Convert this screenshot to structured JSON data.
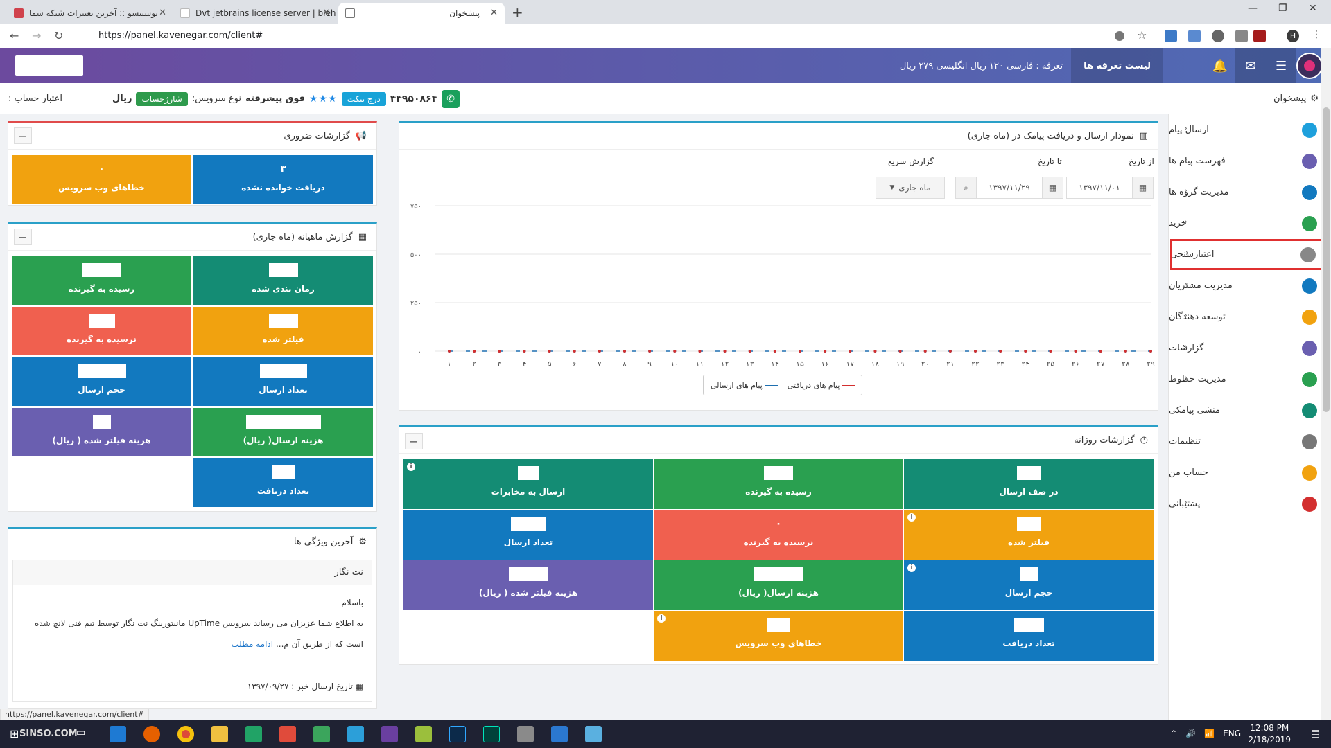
{
  "browser": {
    "tabs": [
      {
        "label": "توسینسو :: آخرین تغییرات شبکه شما"
      },
      {
        "label": "Dvt jetbrains license server | bieh"
      },
      {
        "label": "پیشخوان"
      }
    ],
    "url": "https://panel.kavenegar.com/client#"
  },
  "topbar": {
    "tariff_button": "لیست تعرفه ها",
    "tariff_text": "تعرفه : فارسی ۱۲۰ ریال انگلیسی ۲۷۹ ریال"
  },
  "infobar": {
    "dashboard_label": "پیشخوان",
    "credit_label": "اعتبار حساب :",
    "currency": "ریال",
    "charge_button": "شارژحساب",
    "service_type_label": "نوع سرویس:",
    "service_type_value": "فوق پیشرفته",
    "stars": "★★★",
    "ticket_button": "درج تیکت",
    "phone": "۴۴۹۵۰۸۶۴"
  },
  "sidebar": {
    "items": [
      {
        "label": "ارسال پیام",
        "color": "#1ea0dc"
      },
      {
        "label": "فهرست پیام ها",
        "color": "#6a5fb0"
      },
      {
        "label": "مدیریت گروه ها",
        "color": "#1279bf"
      },
      {
        "label": "خرید",
        "color": "#2aa050"
      },
      {
        "label": "اعتبارسنجی",
        "color": "#888888"
      },
      {
        "label": "مدیریت مشتریان",
        "color": "#1279bf"
      },
      {
        "label": "توسعه دهندگان",
        "color": "#f1a20f"
      },
      {
        "label": "گزارشات",
        "color": "#6a5fb0"
      },
      {
        "label": "مدیریت خطوط",
        "color": "#2aa050"
      },
      {
        "label": "منشی پیامکی",
        "color": "#148c74"
      },
      {
        "label": "تنظیمات",
        "color": "#777777"
      },
      {
        "label": "حساب من",
        "color": "#f1a20f"
      },
      {
        "label": "پشتیبانی",
        "color": "#d32f2f"
      }
    ]
  },
  "urgent": {
    "title": "گزارشات ضروری",
    "tiles": [
      {
        "label": "خطاهای وب سرویس",
        "value": "۰"
      },
      {
        "label": "دریافت خوانده نشده",
        "value": "۳"
      }
    ]
  },
  "monthly": {
    "title": "گزارش ماهیانه (ماه جاری)",
    "tiles": [
      {
        "label": "رسیده به گیرنده"
      },
      {
        "label": "زمان بندی شده"
      },
      {
        "label": "نرسیده به گیرنده"
      },
      {
        "label": "فیلتر شده"
      },
      {
        "label": "حجم ارسال"
      },
      {
        "label": "تعداد ارسال"
      },
      {
        "label": "هزینه فیلتر شده ( ریال)"
      },
      {
        "label": "هزینه ارسال( ریال)"
      },
      {
        "label": "تعداد دریافت"
      }
    ]
  },
  "features": {
    "title": "آخرین ویژگی ها",
    "card_title": "نت نگار",
    "greeting": "باسلام",
    "body": "به اطلاع شما عزیزان می رساند سرویس UpTime مانیتورینگ نت نگار توسط تیم فنی لانچ شده است که از طریق آن م...",
    "read_more": "ادامه مطلب",
    "date_label": "تاریخ ارسال خبر : ۱۳۹۷/۰۹/۲۷"
  },
  "chart_panel": {
    "title": "نمودار ارسال و دریافت پیامک در (ماه جاری)",
    "from_label": "از تاریخ",
    "to_label": "تا تاریخ",
    "quick_label": "گزارش سریع",
    "from_value": "۱۳۹۷/۱۱/۰۱",
    "to_value": "۱۳۹۷/۱۱/۲۹",
    "quick_value": "ماه جاری",
    "legend_sent": "پیام های ارسالی",
    "legend_received": "پیام های دریافتی"
  },
  "chart_data": {
    "type": "line",
    "x": [
      "۱",
      "۲",
      "۳",
      "۴",
      "۵",
      "۶",
      "۷",
      "۸",
      "۹",
      "۱۰",
      "۱۱",
      "۱۲",
      "۱۳",
      "۱۴",
      "۱۵",
      "۱۶",
      "۱۷",
      "۱۸",
      "۱۹",
      "۲۰",
      "۲۱",
      "۲۲",
      "۲۳",
      "۲۴",
      "۲۵",
      "۲۶",
      "۲۷",
      "۲۸",
      "۲۹"
    ],
    "yticks": [
      "۰",
      "۲۵۰",
      "۵۰۰",
      "۷۵۰"
    ],
    "ylim": [
      0,
      750
    ],
    "series": [
      {
        "name": "پیام های ارسالی",
        "color": "#1e6fb0",
        "values": [
          0,
          0,
          0,
          0,
          0,
          0,
          0,
          0,
          0,
          0,
          0,
          0,
          0,
          0,
          0,
          0,
          0,
          0,
          0,
          0,
          0,
          0,
          0,
          0,
          0,
          0,
          0,
          0,
          0
        ]
      },
      {
        "name": "پیام های دریافتی",
        "color": "#d32f2f",
        "values": [
          0,
          0,
          0,
          0,
          0,
          0,
          0,
          0,
          0,
          0,
          0,
          0,
          0,
          0,
          0,
          0,
          0,
          0,
          0,
          0,
          0,
          0,
          0,
          0,
          0,
          0,
          0,
          0,
          0
        ]
      }
    ],
    "grid": true,
    "legend": "bottom-center"
  },
  "daily": {
    "title": "گزارشات روزانه",
    "tiles": [
      {
        "label": "در صف ارسال"
      },
      {
        "label": "رسیده به گیرنده"
      },
      {
        "label": "ارسال به مخابرات"
      },
      {
        "label": "فیلتر شده"
      },
      {
        "label": "نرسیده به گیرنده",
        "value": "۰"
      },
      {
        "label": "تعداد ارسال"
      },
      {
        "label": "حجم ارسال"
      },
      {
        "label": "هزینه ارسال( ریال)"
      },
      {
        "label": "هزینه فیلتر شده ( ریال)"
      },
      {
        "label": "تعداد دریافت"
      },
      {
        "label": "خطاهای وب سرویس"
      }
    ]
  },
  "status_url": "https://panel.kavenegar.com/client#",
  "taskbar": {
    "lang": "ENG",
    "time": "12:08 PM",
    "date": "2/18/2019",
    "watermark": "SINSO.COM"
  }
}
